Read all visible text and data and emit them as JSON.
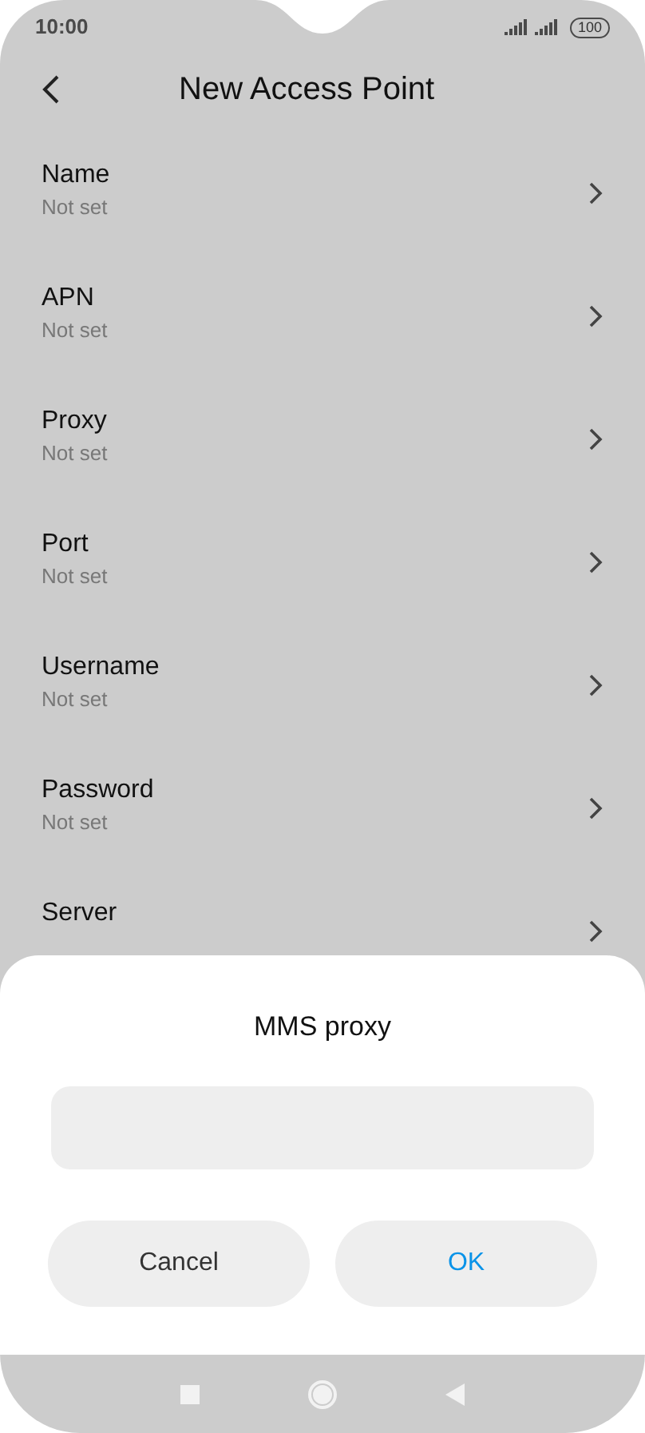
{
  "status_bar": {
    "time": "10:00",
    "battery": "100"
  },
  "header": {
    "title": "New Access Point"
  },
  "settings": [
    {
      "label": "Name",
      "value": "Not set"
    },
    {
      "label": "APN",
      "value": "Not set"
    },
    {
      "label": "Proxy",
      "value": "Not set"
    },
    {
      "label": "Port",
      "value": "Not set"
    },
    {
      "label": "Username",
      "value": "Not set"
    },
    {
      "label": "Password",
      "value": "Not set"
    },
    {
      "label": "Server"
    }
  ],
  "dialog": {
    "title": "MMS proxy",
    "buttons": [
      {
        "label": "Cancel",
        "kind": "neutral"
      },
      {
        "label": "OK",
        "kind": "primary"
      }
    ]
  }
}
